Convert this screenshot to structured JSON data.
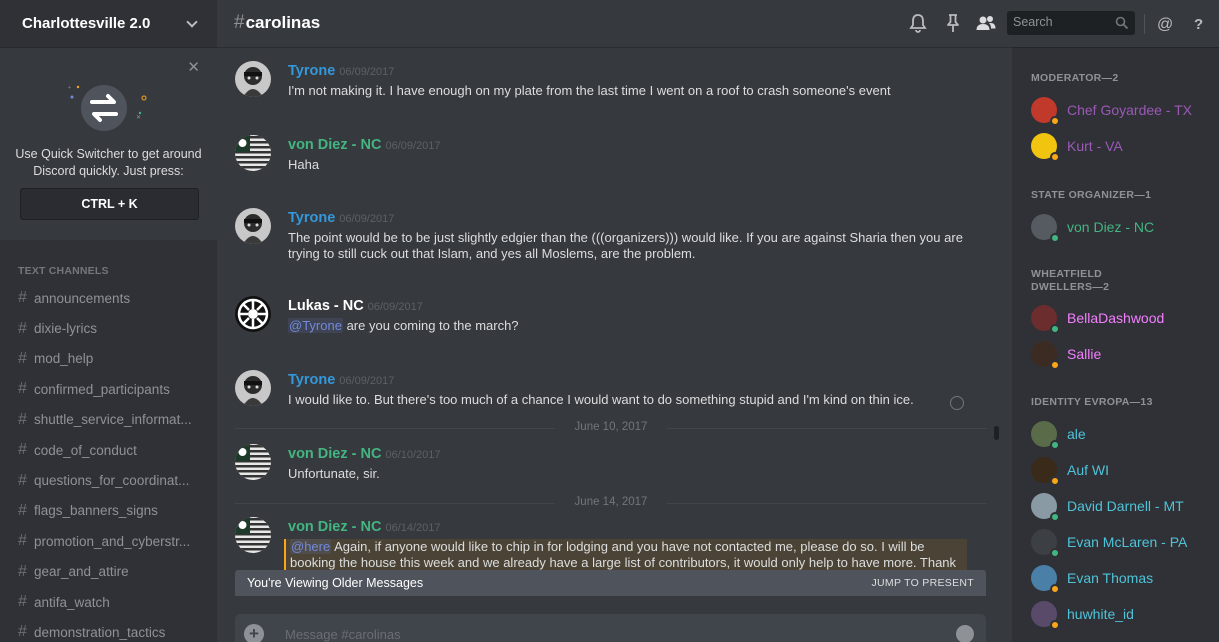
{
  "sidebar": {
    "server_name": "Charlottesville 2.0",
    "quick_switcher": {
      "text_line1": "Use Quick Switcher to get around",
      "text_line2": "Discord quickly. Just press:",
      "shortcut": "CTRL + K"
    },
    "channels_header": "TEXT CHANNELS",
    "channels": [
      "announcements",
      "dixie-lyrics",
      "mod_help",
      "confirmed_participants",
      "shuttle_service_informat...",
      "code_of_conduct",
      "questions_for_coordinat...",
      "flags_banners_signs",
      "promotion_and_cyberstr...",
      "gear_and_attire",
      "antifa_watch",
      "demonstration_tactics"
    ]
  },
  "topbar": {
    "channel_name": "carolinas",
    "search_placeholder": "Search"
  },
  "messages": [
    {
      "author": "Tyrone",
      "color": "#3498db",
      "timestamp": "06/09/2017",
      "text": "I'm not making it. I have enough on my plate from the last time I went on a roof to crash someone's event"
    },
    {
      "author": "von Diez - NC",
      "color": "#43b581",
      "timestamp": "06/09/2017",
      "text": "Haha"
    },
    {
      "author": "Tyrone",
      "color": "#3498db",
      "timestamp": "06/09/2017",
      "text": "The point would be to be just slightly edgier than the (((organizers))) would like. If you are against Sharia then you are trying to still cuck out that Islam, and yes all Moslems, are the problem."
    },
    {
      "author": "Lukas - NC",
      "color": "#ffffff",
      "timestamp": "06/09/2017",
      "mention": "@Tyrone",
      "text": " are you coming to the march?"
    },
    {
      "author": "Tyrone",
      "color": "#3498db",
      "timestamp": "06/09/2017",
      "text": "I would like to. But there's too much of a chance I would want to do something stupid and I'm kind on thin ice."
    },
    {
      "author": "von Diez - NC",
      "color": "#43b581",
      "timestamp": "06/10/2017",
      "text": "Unfortunate, sir."
    },
    {
      "author": "von Diez - NC",
      "color": "#43b581",
      "timestamp": "06/14/2017",
      "mention": "@here",
      "text": "  Again, if anyone would like to chip in for lodging and you have not contacted me, please do so. I will be booking the house this week and we already have a large list of contributors, it would only help to have more. Thank you."
    }
  ],
  "date_dividers": [
    "June 10, 2017",
    "June 14, 2017"
  ],
  "older_bar": {
    "text": "You're Viewing Older Messages",
    "jump": "JUMP TO PRESENT"
  },
  "composer": {
    "placeholder": "Message #carolinas"
  },
  "members": {
    "roles": [
      {
        "name": "MODERATOR—2",
        "members": [
          {
            "name": "Chef Goyardee - TX",
            "color": "#9b59b6",
            "status": "#faa61a",
            "avatar": "#c0392b"
          },
          {
            "name": "Kurt - VA",
            "color": "#9b59b6",
            "status": "#faa61a",
            "avatar": "#f1c40f"
          }
        ]
      },
      {
        "name": "STATE ORGANIZER—1",
        "members": [
          {
            "name": "von Diez - NC",
            "color": "#43b581",
            "status": "#43b581",
            "avatar": "#555b61"
          }
        ]
      },
      {
        "name": "WHEATFIELD DWELLERS—2",
        "members": [
          {
            "name": "BellaDashwood",
            "color": "#f47fff",
            "status": "#43b581",
            "avatar": "#6b2d2d"
          },
          {
            "name": "Sallie",
            "color": "#f47fff",
            "status": "#faa61a",
            "avatar": "#3b2b22"
          }
        ]
      },
      {
        "name": "IDENTITY EVROPA—13",
        "members": [
          {
            "name": "ale",
            "color": "#4fc3d9",
            "status": "#43b581",
            "avatar": "#5a6b4a"
          },
          {
            "name": "Auf WI",
            "color": "#4fc3d9",
            "status": "#faa61a",
            "avatar": "#3a2a1a"
          },
          {
            "name": "David Darnell - MT",
            "color": "#4fc3d9",
            "status": "#43b581",
            "avatar": "#8a9aa5"
          },
          {
            "name": "Evan McLaren - PA",
            "color": "#4fc3d9",
            "status": "#43b581",
            "avatar": "#3c3f44"
          },
          {
            "name": "Evan Thomas",
            "color": "#4fc3d9",
            "status": "#faa61a",
            "avatar": "#4a7fa8"
          },
          {
            "name": "huwhite_id",
            "color": "#4fc3d9",
            "status": "#faa61a",
            "avatar": "#5a4a6a"
          }
        ]
      }
    ]
  }
}
